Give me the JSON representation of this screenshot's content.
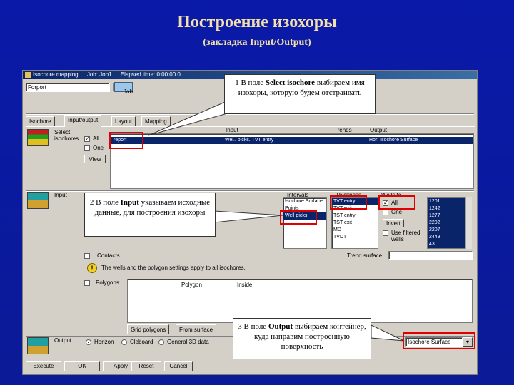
{
  "slide": {
    "title": "Построение изохоры",
    "subtitle": "(закладка Input/Output)"
  },
  "window": {
    "title_parts": [
      "Isochore mapping",
      "Job: Job1",
      "Elapsed time: 0:00:00.0"
    ],
    "project_field": "Forport",
    "job_label": "Job",
    "tabs": [
      "Isochore",
      "Input/output",
      "Layout",
      "Mapping"
    ],
    "active_tab_index": 1
  },
  "select_section": {
    "label_line1": "Select",
    "label_line2": "isochores",
    "all_label": "All",
    "one_label": "One",
    "view_button": "View",
    "columns": [
      "Input",
      "Trends",
      "Output"
    ],
    "row": {
      "name": "report",
      "input": "Wel.. picks..TVT entry",
      "trends": "",
      "output": "Hor: Isochore Surface"
    }
  },
  "input_section": {
    "label": "Input",
    "list_header": "Intervals",
    "list_items": [
      "Isochore Surface",
      "Points",
      "Well picks"
    ],
    "list_selected_index": 2,
    "thickness_header": "Thickness",
    "thickness_items": [
      "TVT entry",
      "TVT exit",
      "TST entry",
      "TST exit",
      "MD",
      "TVDT"
    ],
    "thickness_selected_index": 0,
    "wells_header": "Wells to",
    "all_label": "All",
    "one_label": "One",
    "invert_button": "Invert",
    "use_filtered_line1": "Use filtered",
    "use_filtered_line2": "wells",
    "wells_items": [
      "1201",
      "1242",
      "1277",
      "2202",
      "2207",
      "2449",
      "43"
    ],
    "contacts_label": "Contacts",
    "trend_label": "Trend surface",
    "info_text": "The wells and the polygon settings apply to all isochores.",
    "polygons_label": "Polygons",
    "polygon_header": "Polygon",
    "inside_header": "Inside",
    "polygon_tabs": [
      "Grid polygons",
      "From surface"
    ]
  },
  "output_section": {
    "label": "Output",
    "radio_options": [
      "Horizon",
      "Cleboard",
      "General 3D data"
    ],
    "radio_selected_index": 0,
    "output_value": "Isochore Surface"
  },
  "buttons": [
    "Execute",
    "OK",
    "Apply",
    "Reset",
    "Cancel"
  ],
  "callouts": {
    "c1": {
      "number": "1",
      "pre": "В поле ",
      "field": "Select isochore",
      "post": " выбираем имя изохоры, которую будем отстраивать"
    },
    "c2": {
      "number": "2",
      "pre": "В поле ",
      "field": "Input",
      "post": " указываем исходные данные, для построения изохоры"
    },
    "c3": {
      "number": "3",
      "pre": "В поле ",
      "field": "Output",
      "post": " выбираем контейнер, куда направим построенную поверхность"
    }
  },
  "colors": {
    "slide_bg": "#0b1a9e",
    "title": "#f3e0a8",
    "highlight": "#e00000",
    "selection": "#0a246a"
  }
}
